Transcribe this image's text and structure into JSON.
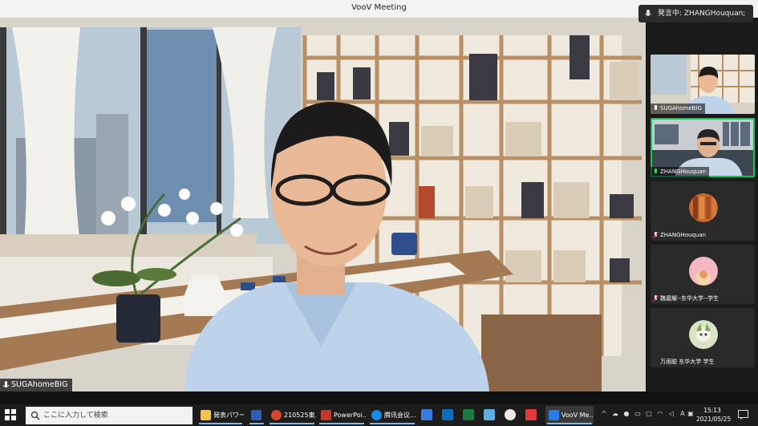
{
  "window": {
    "title": "VooV Meeting"
  },
  "speaking": {
    "label": "発言中: ZHANGHouquan;"
  },
  "main_video": {
    "name": "SUGAhomeBIG"
  },
  "participants": [
    {
      "name": "SUGAhomeBIG",
      "kind": "video"
    },
    {
      "name": "ZHANGHouquan",
      "kind": "video",
      "active": true
    },
    {
      "name": "ZHANGHouquan",
      "kind": "avatar"
    },
    {
      "name": "魏嘉耀--东华大学--学生",
      "kind": "avatar"
    },
    {
      "name": "万雨聪 东华大学 学生",
      "kind": "avatar"
    }
  ],
  "taskbar": {
    "search_placeholder": "ここに入力して検索",
    "apps": [
      {
        "label": "発表パワー..."
      },
      {
        "label": ""
      },
      {
        "label": "210525東..."
      },
      {
        "label": "PowerPoi..."
      },
      {
        "label": "腾讯会议..."
      },
      {
        "label": "VooV Me..."
      }
    ],
    "clock_time": "15:13",
    "clock_date": "2021/05/25",
    "ime_label": "A"
  },
  "colors": {
    "active_border": "#18c05a",
    "taskbar": "#1c1c1c"
  }
}
